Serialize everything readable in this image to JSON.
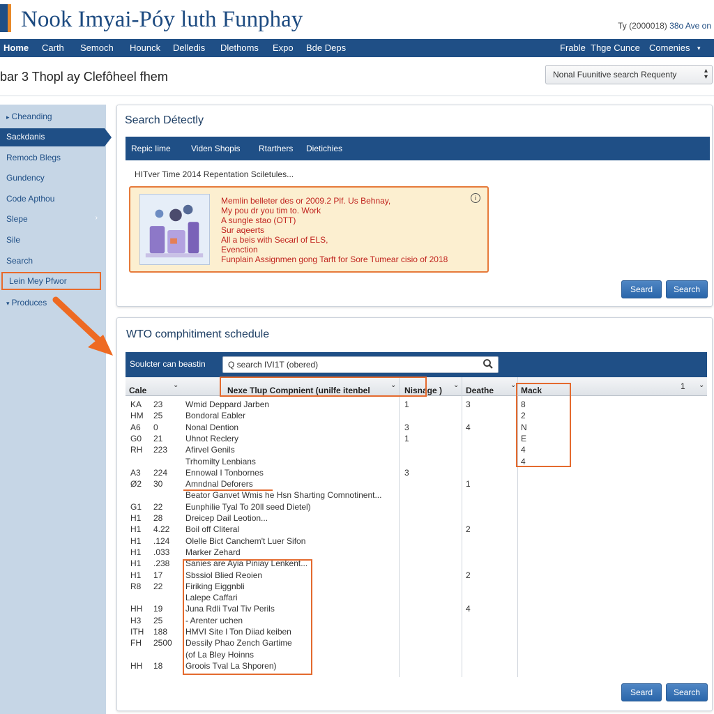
{
  "header": {
    "site_title": "Nook Imyai-Póy luth Funphay",
    "top_right_prefix": "Ty (2000018)",
    "top_right_link": "38o Ave on"
  },
  "topnav": {
    "items": [
      "Home",
      "Carth",
      "Semoch",
      "Hounck",
      "Delledis",
      "Dlethoms",
      "Expo",
      "Bde Deps"
    ],
    "right_items": [
      "Frable",
      "Thge Cunce",
      "Comenies"
    ]
  },
  "subbar": {
    "page_title": "bar 3 Thopl ay Clefôheel fhem",
    "sort_select_value": "Nonal Fuunitive search Requenty"
  },
  "sidebar": {
    "items": [
      {
        "label": "Cheanding"
      },
      {
        "label": "Sackdanis"
      },
      {
        "label": "Remocb Blegs"
      },
      {
        "label": "Gundency"
      },
      {
        "label": "Code Apthou"
      },
      {
        "label": "Slepe"
      },
      {
        "label": "Sile"
      },
      {
        "label": "Search"
      },
      {
        "label": "Lein Mey Pfwor"
      },
      {
        "label": "Produces"
      }
    ]
  },
  "search_panel": {
    "title": "Search Détectly",
    "tabs": [
      "Repic Iime",
      "Viden Shopis",
      "Rtarthers",
      "Dietichies"
    ],
    "result_line": "HITver Time 2014 Repentation Sciletules...",
    "notice": {
      "lines": [
        "Memlin belleter des or 2009.2 Plf. Us Behnay,",
        "My pou dr you tim to. Work",
        "A sungle stao (OTT)",
        "Sur aqeerts",
        "All a beis with Secarl of ELS,",
        "Evenction",
        "Funplain Assignmen gong Tarft for Sore Tumear cisio of 2018"
      ],
      "info_icon": "i"
    },
    "buttons": [
      "Seard",
      "Search"
    ]
  },
  "schedule_panel": {
    "title": "WTO comphitiment schedule",
    "search_label": "Soulcter can beastin",
    "search_value": "Q search IVI1T (obered)",
    "columns": {
      "c1": "Cale",
      "c2": "Nexe Tlup Compnient (unilfe itenbel",
      "c3": "Nisnage )",
      "c4": "Deathe",
      "c5": "Mack",
      "c6": "1"
    },
    "rows": [
      {
        "a": "KA",
        "b": "23",
        "name": "Wmid Deppard Jarben",
        "n": "1",
        "d": "3",
        "m": "8"
      },
      {
        "a": "HM",
        "b": "25",
        "name": "Bondoral Eabler",
        "n": "",
        "d": "",
        "m": "2"
      },
      {
        "a": "A6",
        "b": "0",
        "name": "Nonal Dention",
        "n": "3",
        "d": "4",
        "m": "N"
      },
      {
        "a": "G0",
        "b": "21",
        "name": "Uhnot Reclery",
        "n": "1",
        "d": "",
        "m": "E"
      },
      {
        "a": "RH",
        "b": "223",
        "name": "Afirvel Genils",
        "n": "",
        "d": "",
        "m": "4"
      },
      {
        "a": "",
        "b": "",
        "name": "Trhomilty Lenbians",
        "n": "",
        "d": "",
        "m": "4"
      },
      {
        "a": "A3",
        "b": "224",
        "name": "Ennowal I Tonbornes",
        "n": "3",
        "d": "",
        "m": ""
      },
      {
        "a": "Ø2",
        "b": "30",
        "name": "Amndnal Deforers",
        "n": "",
        "d": "1",
        "m": ""
      },
      {
        "a": "",
        "b": "",
        "name": "Beator Ganvet Wmis he Hsn Sharting Comnotinent...",
        "n": "",
        "d": "",
        "m": ""
      },
      {
        "a": "G1",
        "b": "22",
        "name": "Eunphilie Tyal To 20ll seed Dietel)",
        "n": "",
        "d": "",
        "m": ""
      },
      {
        "a": "H1",
        "b": "28",
        "name": "Dreicep Dail Leotion...",
        "n": "",
        "d": "",
        "m": ""
      },
      {
        "a": "H1",
        "b": "4.22",
        "name": "Boil off Cliteral",
        "n": "",
        "d": "2",
        "m": ""
      },
      {
        "a": "H1",
        "b": ".124",
        "name": "Olelle Bict Canchem't Luer Sifon",
        "n": "",
        "d": "",
        "m": ""
      },
      {
        "a": "H1",
        "b": ".033",
        "name": "Marker Zehard",
        "n": "",
        "d": "",
        "m": ""
      },
      {
        "a": "H1",
        "b": ".238",
        "name": "Sanies are Ayia Piniay Lenkent...",
        "n": "",
        "d": "",
        "m": ""
      },
      {
        "a": "H1",
        "b": "17",
        "name": "Sbssiol Blied Reoien",
        "n": "",
        "d": "2",
        "m": ""
      },
      {
        "a": "R8",
        "b": "22",
        "name": "Firiking Eiggnbli",
        "n": "",
        "d": "",
        "m": ""
      },
      {
        "a": "",
        "b": "",
        "name": "Lalepe Caffari",
        "n": "",
        "d": "",
        "m": ""
      },
      {
        "a": "HH",
        "b": "19",
        "name": "Juna Rdli Tval Tiv Perils",
        "n": "",
        "d": "4",
        "m": ""
      },
      {
        "a": "H3",
        "b": "25",
        "name": "- Arenter uchen",
        "n": "",
        "d": "",
        "m": ""
      },
      {
        "a": "ITH",
        "b": "188",
        "name": "HMVI Site l Ton Diiad keiben",
        "n": "",
        "d": "",
        "m": ""
      },
      {
        "a": "FH",
        "b": "2500",
        "name": "Dessily Phao Zench Gartime",
        "n": "",
        "d": "",
        "m": ""
      },
      {
        "a": "",
        "b": "",
        "name": "(of La Bley Hoinns",
        "n": "",
        "d": "",
        "m": ""
      },
      {
        "a": "HH",
        "b": "18",
        "name": "Groois Tval La Shporen)",
        "n": "",
        "d": "",
        "m": ""
      },
      {
        "a": "",
        "b": "",
        "name": "",
        "n": "",
        "d": "",
        "m": ""
      }
    ],
    "buttons": [
      "Seard",
      "Search"
    ]
  },
  "colors": {
    "brand": "#1f4f86",
    "highlight": "#e46a2e",
    "notice_bg": "#fcefd0",
    "sidebar_bg": "#c6d6e6"
  }
}
